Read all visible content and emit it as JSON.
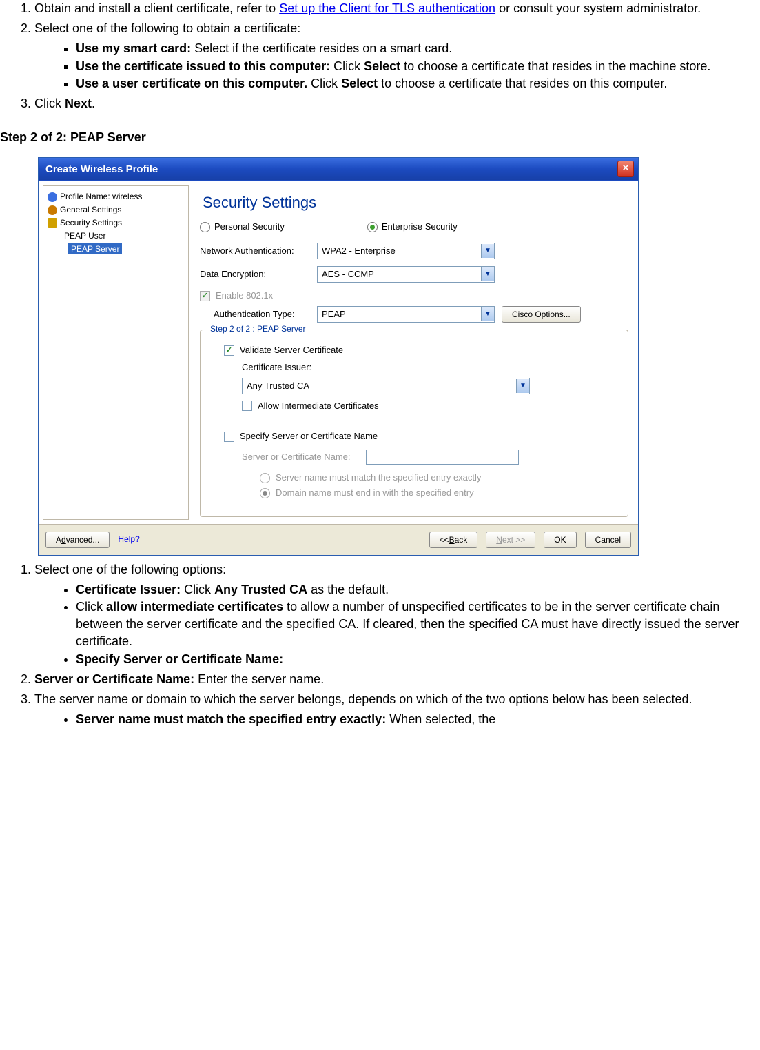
{
  "doc": {
    "list1": {
      "item1_pre": "Obtain and install a client certificate, refer to ",
      "item1_link": "Set up the Client for TLS authentication",
      "item1_post": " or consult your system administrator.",
      "item2": "Select one of the following to obtain a certificate:",
      "sub2": {
        "a_bold": "Use my smart card:",
        "a_text": " Select if the certificate resides on a smart card.",
        "b_bold": "Use the certificate issued to this computer:",
        "b_text_pre": " Click ",
        "b_text_bold": "Select",
        "b_text_post": " to choose a certificate that resides in the machine store.",
        "c_bold": "Use a user certificate on this computer.",
        "c_text_pre": " Click ",
        "c_text_bold": "Select",
        "c_text_post": " to choose a certificate that resides on this computer."
      },
      "item3_pre": "Click ",
      "item3_bold": "Next",
      "item3_post": "."
    },
    "step_heading": "Step 2 of 2: PEAP Server",
    "list2": {
      "item1": "Select one of the following options:",
      "sub1": {
        "a_bold": "Certificate Issuer:",
        "a_text_pre": " Click ",
        "a_text_bold": "Any Trusted CA",
        "a_text_post": " as the default.",
        "b_pre": "Click ",
        "b_bold": "allow intermediate certificates",
        "b_post": " to allow a number of unspecified certificates to be in the server certificate chain between the server certificate and the specified CA. If cleared, then the specified CA must have directly issued the server certificate.",
        "c_bold": "Specify Server or Certificate Name:"
      },
      "item2_bold": "Server or Certificate Name:",
      "item2_text": " Enter the server name.",
      "item3": "The server name or domain to which the server belongs, depends on which of the two options below has been selected.",
      "sub3": {
        "a_bold": "Server name must match the specified entry exactly:",
        "a_text": " When selected, the"
      }
    }
  },
  "win": {
    "title": "Create Wireless Profile",
    "tree": {
      "profile": "Profile Name: wireless",
      "general": "General Settings",
      "security": "Security Settings",
      "peap_user": "PEAP User",
      "peap_server": "PEAP Server"
    },
    "main_title": "Security Settings",
    "radios": {
      "personal": "Personal Security",
      "enterprise": "Enterprise Security"
    },
    "labels": {
      "net_auth": "Network Authentication:",
      "data_enc": "Data Encryption:",
      "enable_8021x": "Enable 802.1x",
      "auth_type": "Authentication Type:",
      "cisco": "Cisco Options...",
      "validate": "Validate Server Certificate",
      "cert_issuer": "Certificate Issuer:",
      "allow_int": "Allow Intermediate Certificates",
      "specify": "Specify Server or Certificate Name",
      "server_name": "Server or Certificate Name:",
      "match_exact": "Server name must match the specified entry exactly",
      "match_domain": "Domain name must end in with the specified entry"
    },
    "values": {
      "net_auth": "WPA2 - Enterprise",
      "data_enc": "AES - CCMP",
      "auth_type": "PEAP",
      "cert_issuer": "Any Trusted CA"
    },
    "legend": "Step 2 of 2 : PEAP Server",
    "foot": {
      "advanced": "Advanced...",
      "help": "Help?",
      "back": "<< Back",
      "next": "Next >>",
      "ok": "OK",
      "cancel": "Cancel"
    }
  }
}
